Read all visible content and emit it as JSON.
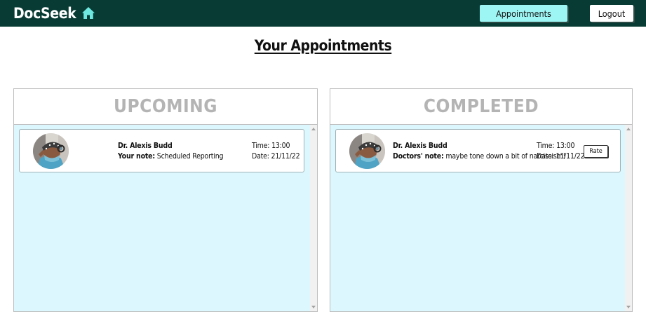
{
  "navbar": {
    "brand": "DocSeek",
    "appointments_label": "Appointments",
    "logout_label": "Logout",
    "colors": {
      "background": "#073b33",
      "accent": "#9df6f4"
    }
  },
  "page": {
    "title": "Your Appointments"
  },
  "upcoming": {
    "title": "UPCOMING",
    "appointments": [
      {
        "doctor": "Dr. Alexis Budd",
        "note_label": "Your note:",
        "note": "Scheduled Reporting",
        "time": "Time: 13:00",
        "date": "Date: 21/11/22"
      }
    ]
  },
  "completed": {
    "title": "COMPLETED",
    "appointments": [
      {
        "doctor": "Dr. Alexis Budd",
        "note_label": "Doctors' note:",
        "note": "maybe tone down a bit of narcissism!",
        "time": "Time: 13:00",
        "date": "Date: 11/11/22",
        "rate_label": "Rate"
      }
    ]
  }
}
